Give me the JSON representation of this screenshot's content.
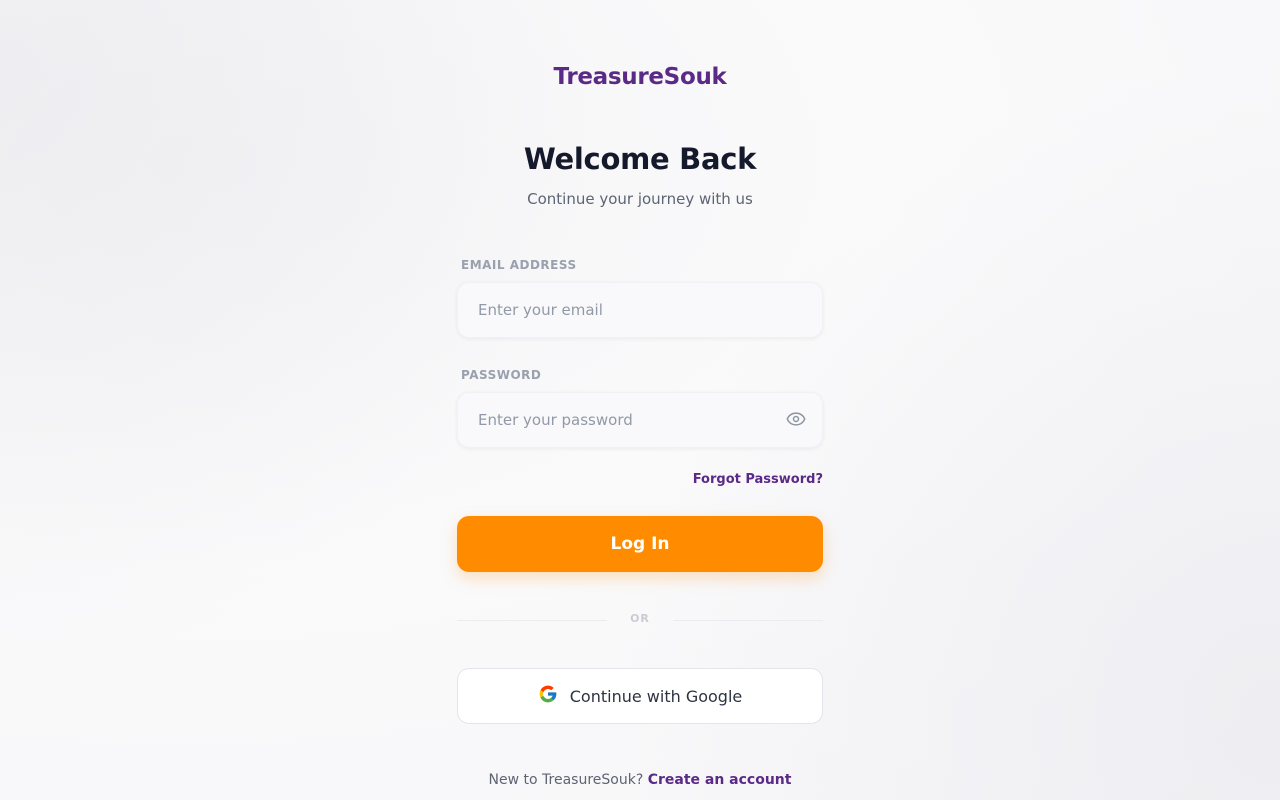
{
  "brand": {
    "name": "TreasureSouk"
  },
  "header": {
    "title": "Welcome Back",
    "subtitle": "Continue your journey with us"
  },
  "form": {
    "email": {
      "label": "EMAIL ADDRESS",
      "placeholder": "Enter your email",
      "value": ""
    },
    "password": {
      "label": "PASSWORD",
      "placeholder": "Enter your password",
      "value": "",
      "toggle_icon": "eye-icon"
    },
    "forgot_label": "Forgot Password?",
    "login_label": "Log In",
    "divider_label": "OR",
    "google_label": "Continue with Google"
  },
  "signup": {
    "prompt": "New to TreasureSouk?",
    "link_label": "Create an account"
  },
  "colors": {
    "brand": "#5b2a86",
    "primary_button": "#ff8c00",
    "title": "#141a2b"
  }
}
